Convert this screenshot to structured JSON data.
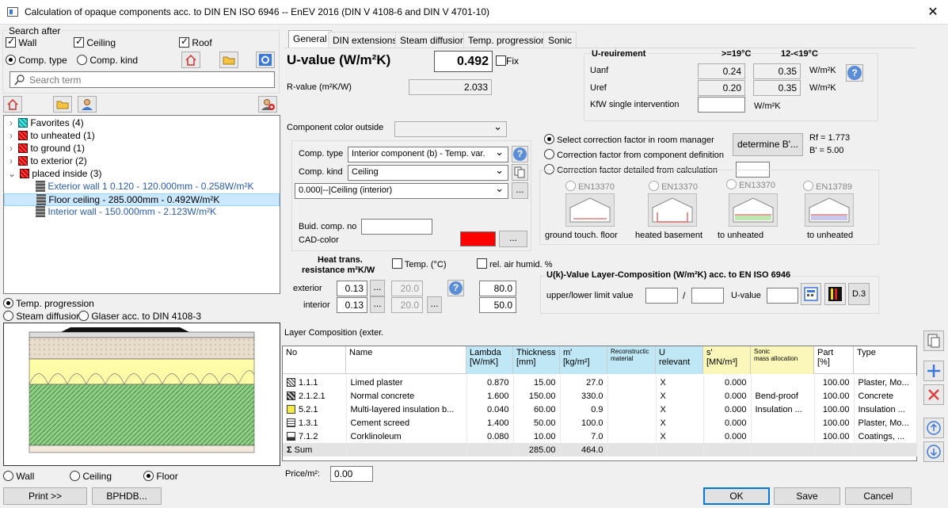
{
  "window": {
    "title": "Calculation of opaque components acc. to DIN EN ISO 6946 -- EnEV 2016 (DIN V 4108-6 and DIN V 4701-10)",
    "close": "✕"
  },
  "search": {
    "group_label": "Search after",
    "wall": "Wall",
    "ceiling": "Ceiling",
    "roof": "Roof",
    "comp_type": "Comp. type",
    "comp_kind": "Comp. kind",
    "placeholder": "Search term"
  },
  "tree": {
    "items": [
      {
        "label": "Favorites (4)"
      },
      {
        "label": "to unheated (1)"
      },
      {
        "label": "to ground (1)"
      },
      {
        "label": "to exterior (2)"
      },
      {
        "label": "placed inside (3)"
      }
    ],
    "children": [
      {
        "label": "Exterior wall 1 0.120 - 120.000mm - 0.258W/m²K"
      },
      {
        "label": "Floor ceiling - 285.000mm - 0.492W/m²K"
      },
      {
        "label": "Interior wall - 150.000mm - 2.123W/m²K"
      }
    ]
  },
  "view": {
    "temp_progression": "Temp. progression",
    "steam_diffusion": "Steam diffusion",
    "glaser": "Glaser acc. to  DIN 4108-3",
    "wall": "Wall",
    "ceiling": "Ceiling",
    "floor": "Floor"
  },
  "buttons": {
    "print": "Print >>",
    "bphdb": "BPHDB...",
    "ok": "OK",
    "save": "Save",
    "cancel": "Cancel",
    "determine": "determine B'...",
    "ellipsis": "...",
    "d3": "D.3"
  },
  "tabs": [
    "General",
    "DIN extensions",
    "Steam diffusion",
    "Temp. progression",
    "Sonic"
  ],
  "general": {
    "u_value_label": "U-value  (W/m²K)",
    "u_value": "0.492",
    "fix": "Fix",
    "r_value_label": "R-value (m²K/W)",
    "r_value": "2.033",
    "color_outside": "Component color outside",
    "comp_type_label": "Comp. type",
    "comp_type_value": "Interior component (b) - Temp. var.",
    "comp_kind_label": "Comp. kind",
    "comp_kind_value": "Ceiling",
    "catalog_value": "0.000|--|Ceiling (interior)",
    "buid_no": "Buid. comp. no",
    "cad_color": "CAD-color",
    "cad_color_hex": "#ff0000",
    "heat_res_title_1": "Heat trans.",
    "heat_res_title_2": "resistance m²K/W",
    "temp_c": "Temp. (°C)",
    "rel_air": "rel. air humid. %",
    "exterior": "exterior",
    "interior": "interior",
    "ext_r": "0.13",
    "int_r": "0.13",
    "ext_t": "20.0",
    "int_t": "20.0",
    "ext_h": "80.0",
    "int_h": "50.0"
  },
  "ureq": {
    "title": "U-reuirement",
    "col1": ">=19°C",
    "col2": "12-<19°C",
    "uanf": "Uanf",
    "uanf1": "0.24",
    "uanf2": "0.35",
    "uref": "Uref",
    "uref1": "0.20",
    "uref2": "0.35",
    "unit": "W/m²K",
    "kfw": "KfW single intervention",
    "kfw_unit": "W/m²K"
  },
  "correction": {
    "opt1": "Select correction factor in room manager",
    "opt2": "Correction factor from component definition",
    "opt3": "Correction factor detailed from calculation",
    "rf": "Rf = 1.773",
    "b": "B' = 5.00",
    "std1": "EN13370",
    "std2": "EN13370",
    "std3": "EN13370",
    "std4": "EN13789",
    "cap1": "ground touch. floor",
    "cap2": "heated basement",
    "cap3": "to unheated",
    "cap4": "to unheated"
  },
  "ukvalue": {
    "title": "U(k)-Value Layer-Composition (W/m²K) acc. to EN ISO 6946",
    "limit": "upper/lower limit value",
    "slash": "/",
    "uvalue": "U-value"
  },
  "layers": {
    "title": "Layer Composition (exter.",
    "headers": {
      "no": "No",
      "name": "Name",
      "lambda1": "Lambda",
      "lambda2": "[W/mK]",
      "thick1": "Thickness",
      "thick2": "[mm]",
      "m1": "m'",
      "m2": "[kg/m²]",
      "recon1": "Reconstructic",
      "recon2": "material",
      "u1": "U",
      "u2": "relevant",
      "s1": "s'",
      "s2": "[MN/m³]",
      "sonic1": "Sonic",
      "sonic2": "mass allocation",
      "part1": "Part",
      "part2": "[%]",
      "type": "Type"
    },
    "rows": [
      {
        "no": "1.1.1",
        "name": "Limed plaster",
        "lambda": "0.870",
        "thick": "15.00",
        "m": "27.0",
        "u": "X",
        "s": "0.000",
        "sonic": "",
        "part": "100.00",
        "type": "Plaster, Mo..."
      },
      {
        "no": "2.1.2.1",
        "name": "Normal concrete",
        "lambda": "1.600",
        "thick": "150.00",
        "m": "330.0",
        "u": "X",
        "s": "0.000",
        "sonic": "Bend-proof",
        "part": "100.00",
        "type": "Concrete"
      },
      {
        "no": "5.2.1",
        "name": "Multi-layered insulation b...",
        "lambda": "0.040",
        "thick": "60.00",
        "m": "0.9",
        "u": "X",
        "s": "0.000",
        "sonic": "Insulation ...",
        "part": "100.00",
        "type": "Insulation ..."
      },
      {
        "no": "1.3.1",
        "name": "Cement screed",
        "lambda": "1.400",
        "thick": "50.00",
        "m": "100.0",
        "u": "X",
        "s": "0.000",
        "sonic": "",
        "part": "100.00",
        "type": "Plaster, Mo..."
      },
      {
        "no": "7.1.2",
        "name": "Corklinoleum",
        "lambda": "0.080",
        "thick": "10.00",
        "m": "7.0",
        "u": "X",
        "s": "0.000",
        "sonic": "",
        "part": "100.00",
        "type": "Coatings, ..."
      }
    ],
    "sum_label": "Sum",
    "sum_thick": "285.00",
    "sum_m": "464.0"
  },
  "price": {
    "label": "Price/m²:",
    "value": "0.00"
  },
  "colors": {
    "accent": "#3c78d8",
    "hdr_blue": "#bfe7f6",
    "hdr_yellow": "#fbf7b9",
    "selection": "#cce8ff"
  }
}
